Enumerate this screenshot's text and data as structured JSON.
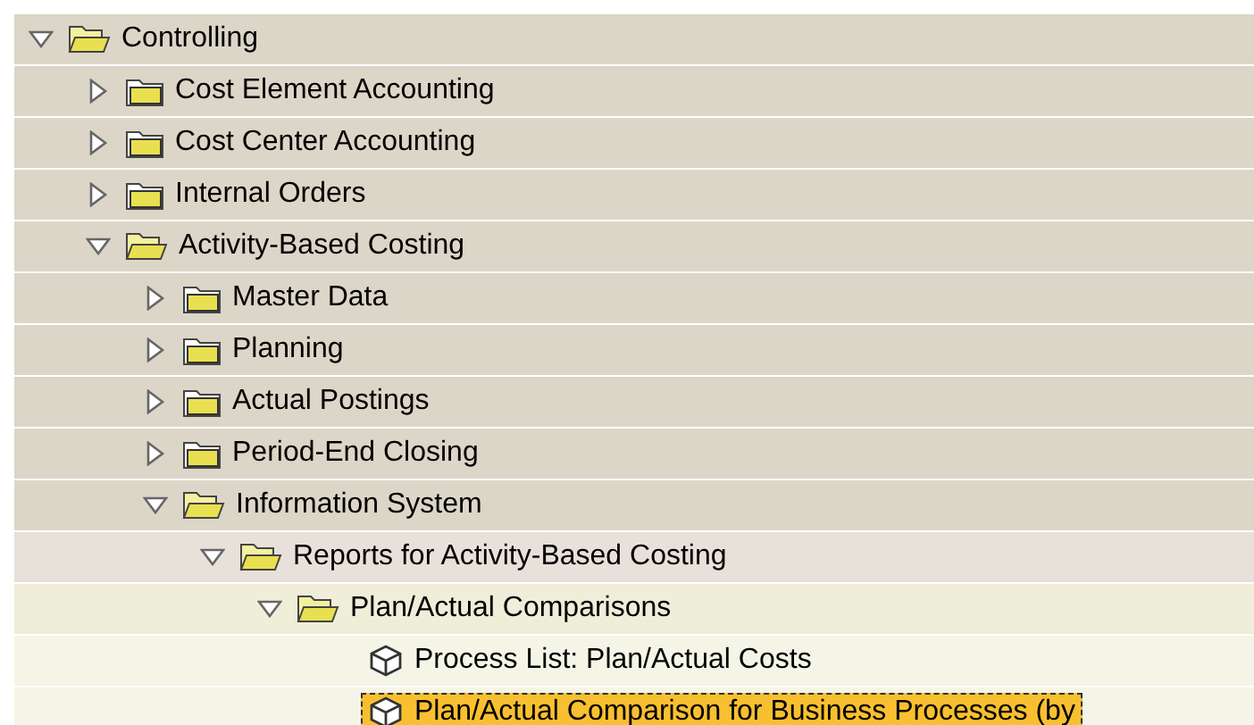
{
  "tree": [
    {
      "label": "Controlling",
      "kind": "folder",
      "expanded": true,
      "selected": false,
      "children": [
        {
          "label": "Cost Element Accounting",
          "kind": "folder",
          "expanded": false,
          "selected": false
        },
        {
          "label": "Cost Center Accounting",
          "kind": "folder",
          "expanded": false,
          "selected": false
        },
        {
          "label": "Internal Orders",
          "kind": "folder",
          "expanded": false,
          "selected": false
        },
        {
          "label": "Activity-Based Costing",
          "kind": "folder",
          "expanded": true,
          "selected": false,
          "children": [
            {
              "label": "Master Data",
              "kind": "folder",
              "expanded": false,
              "selected": false
            },
            {
              "label": "Planning",
              "kind": "folder",
              "expanded": false,
              "selected": false
            },
            {
              "label": "Actual Postings",
              "kind": "folder",
              "expanded": false,
              "selected": false
            },
            {
              "label": "Period-End Closing",
              "kind": "folder",
              "expanded": false,
              "selected": false
            },
            {
              "label": "Information System",
              "kind": "folder",
              "expanded": true,
              "selected": false,
              "children": [
                {
                  "label": "Reports for Activity-Based Costing",
                  "kind": "folder",
                  "expanded": true,
                  "selected": false,
                  "children": [
                    {
                      "label": "Plan/Actual Comparisons",
                      "kind": "folder",
                      "expanded": true,
                      "selected": false,
                      "children": [
                        {
                          "label": "Process List: Plan/Actual Costs",
                          "kind": "report",
                          "selected": false
                        },
                        {
                          "label": "Plan/Actual Comparison for Business Processes (by",
                          "kind": "report",
                          "selected": true
                        }
                      ]
                    }
                  ]
                }
              ]
            }
          ]
        }
      ]
    }
  ]
}
